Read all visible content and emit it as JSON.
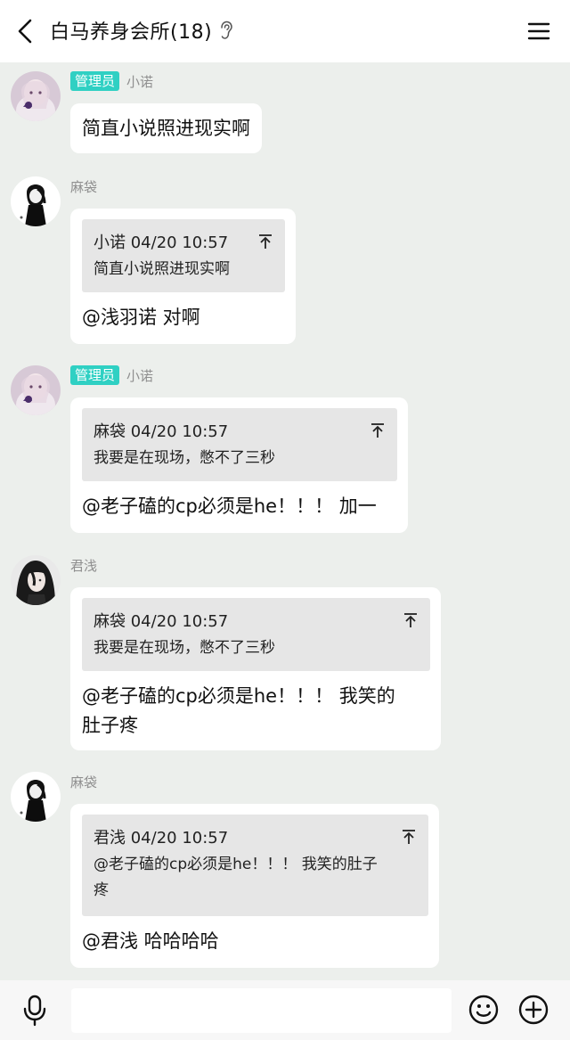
{
  "header": {
    "title": "白马养身会所(18)"
  },
  "messages": [
    {
      "admin_badge": "管理员",
      "sender": "小诺",
      "text": "简直小说照进现实啊",
      "avatar": "avatar-girl-purple"
    },
    {
      "sender": "麻袋",
      "quote": {
        "head": "小诺 04/20 10:57",
        "body": "简直小说照进现实啊"
      },
      "text": "@浅羽诺 对啊",
      "avatar": "avatar-figure-dark"
    },
    {
      "admin_badge": "管理员",
      "sender": "小诺",
      "quote": {
        "head": "麻袋 04/20 10:57",
        "body": "我要是在现场，憋不了三秒"
      },
      "text": "@老子磕的cp必须是he！！！ 加一",
      "avatar": "avatar-girl-purple"
    },
    {
      "sender": "君浅",
      "quote": {
        "head": "麻袋 04/20 10:57",
        "body": "我要是在现场，憋不了三秒"
      },
      "text_line1": "@老子磕的cp必须是he！！！ 我笑的",
      "text_line2": "肚子疼",
      "avatar": "avatar-anime-man"
    },
    {
      "sender": "麻袋",
      "quote": {
        "head": "君浅 04/20 10:57",
        "body_line1": "@老子磕的cp必须是he！！！ 我笑的肚子",
        "body_line2": "疼"
      },
      "text": "@君浅 哈哈哈哈",
      "avatar": "avatar-figure-dark"
    }
  ],
  "input": {
    "placeholder": ""
  },
  "icons": {
    "back": "back-arrow-icon",
    "ear": "ear-icon",
    "menu": "menu-icon",
    "quote_jump": "jump-to-top-icon",
    "mic": "microphone-icon",
    "emoji": "smiley-icon",
    "plus": "plus-circle-icon"
  },
  "colors": {
    "admin_badge": "#2fd0c3",
    "background": "#ecefec",
    "quote_bg": "#e6e6e6"
  }
}
